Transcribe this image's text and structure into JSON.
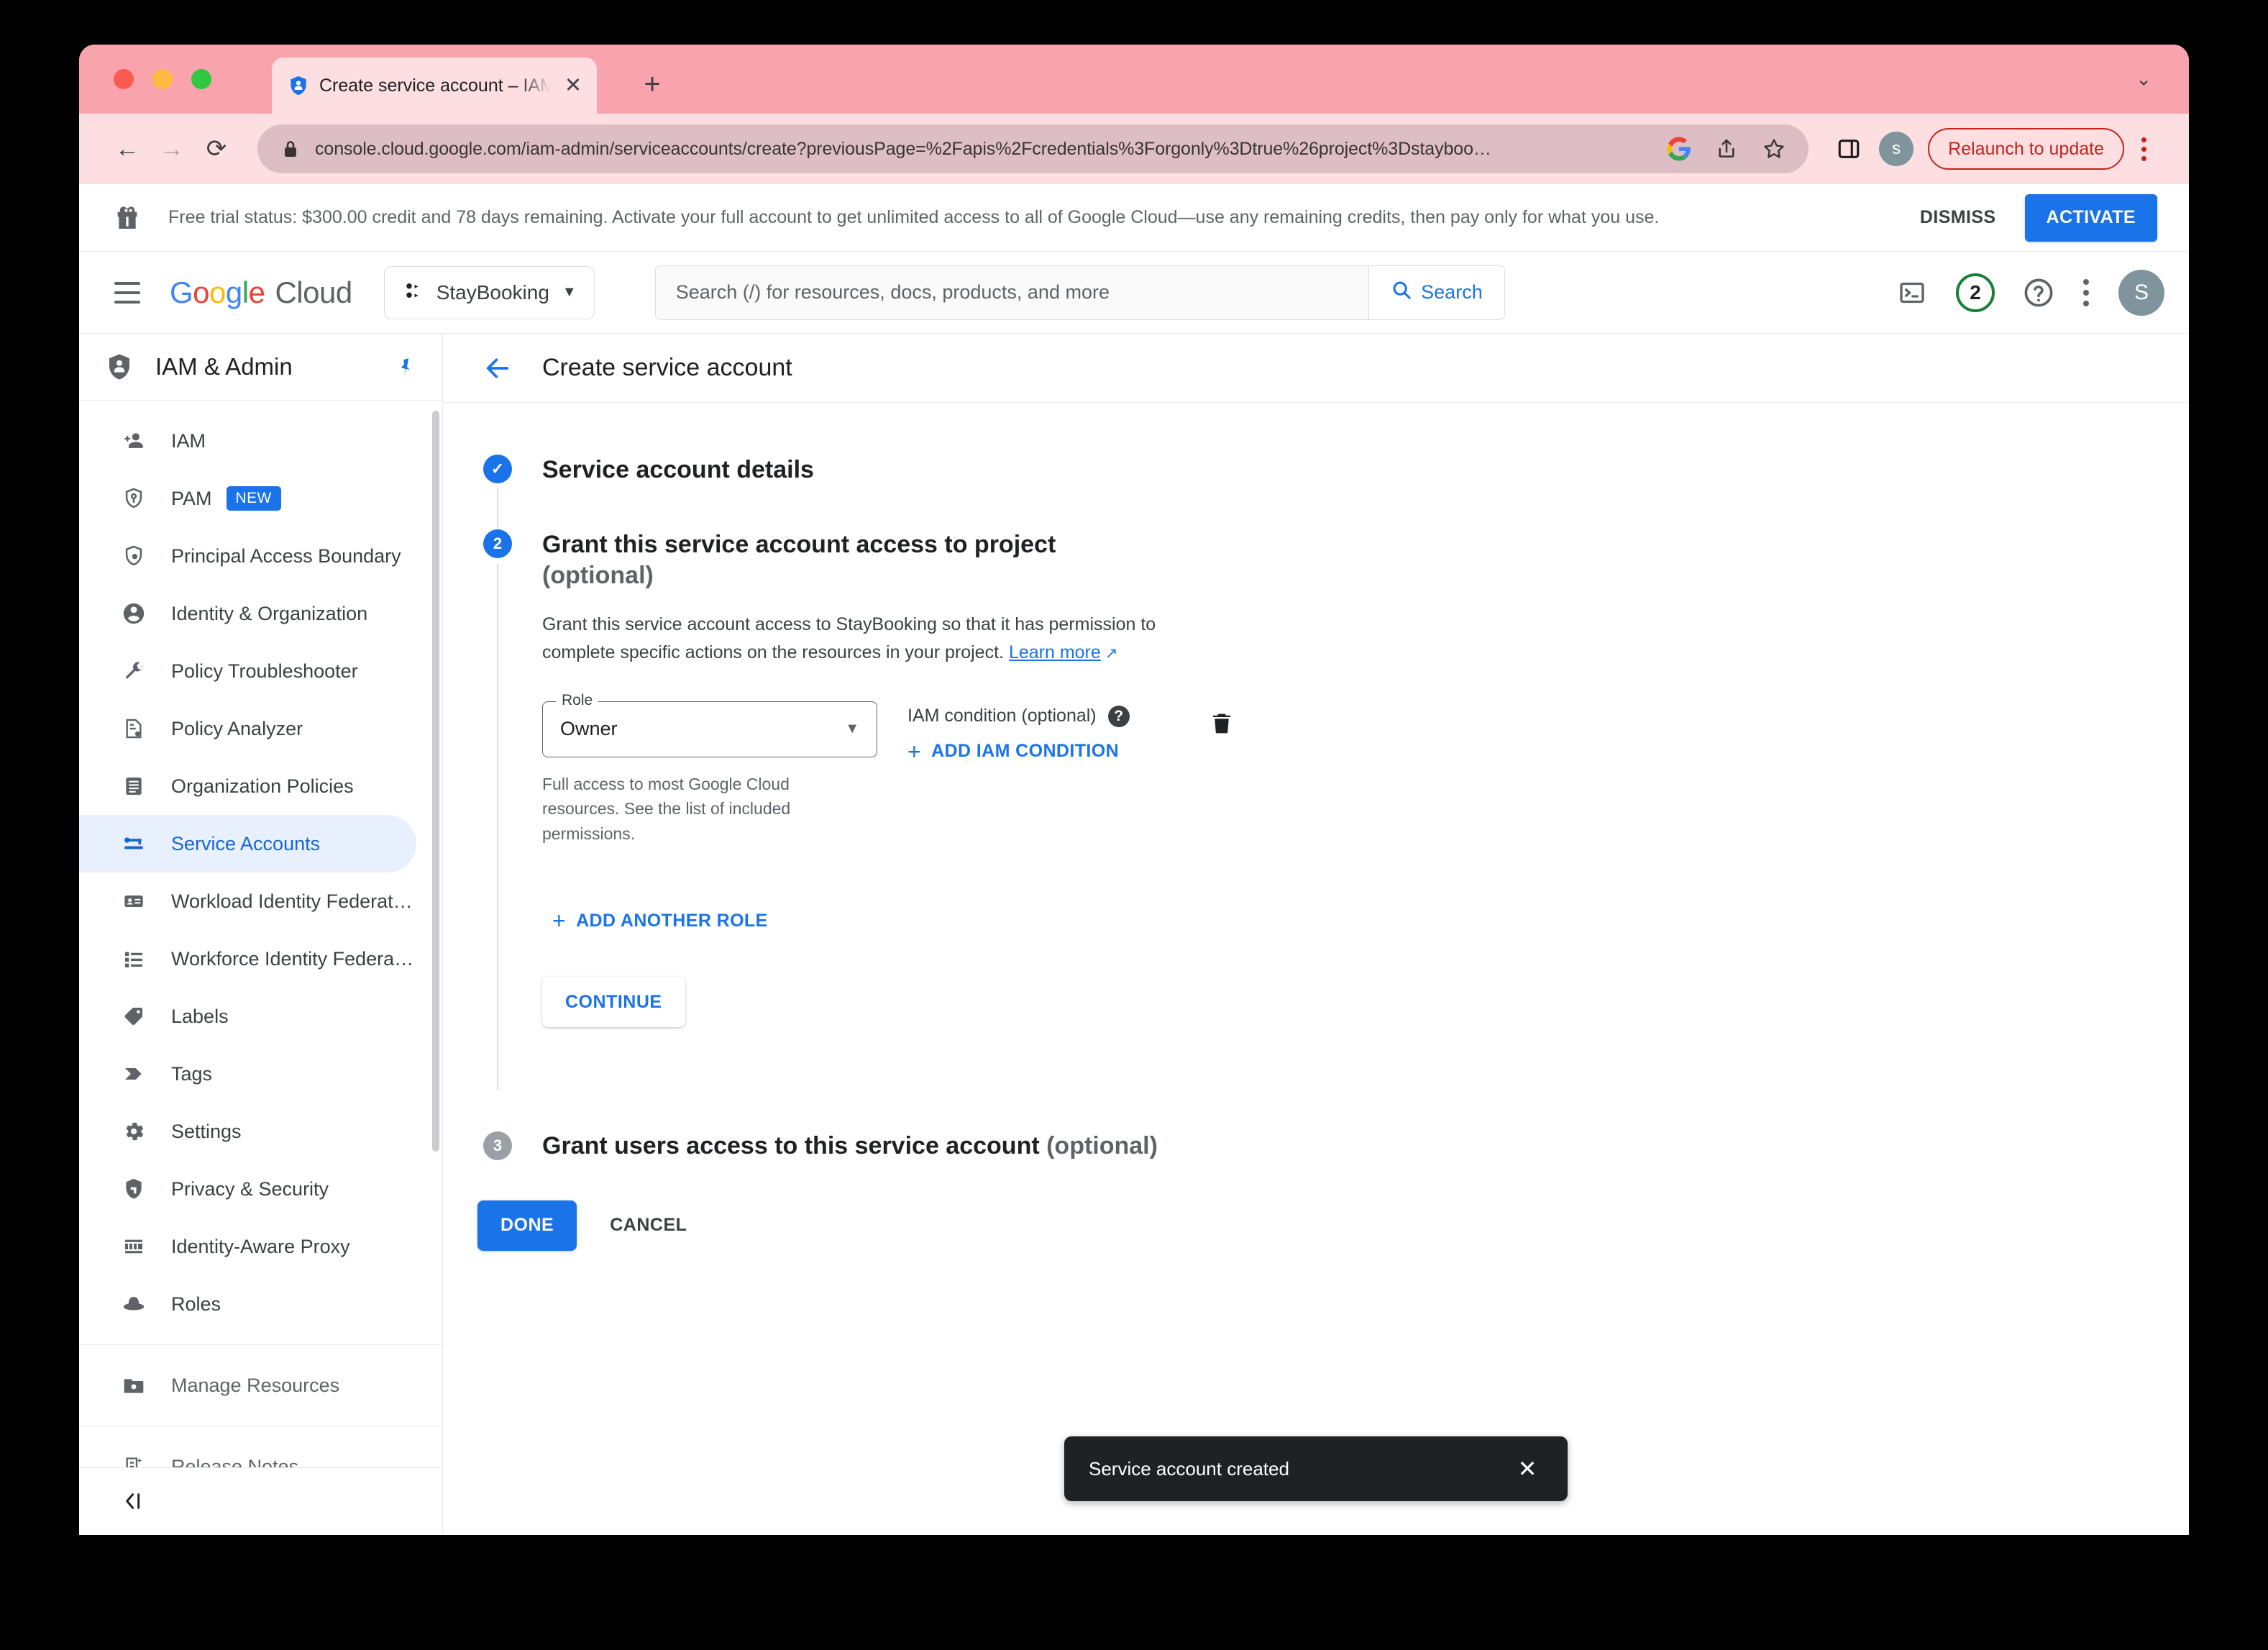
{
  "browser": {
    "tab": {
      "title": "Create service account – IAM & Admin",
      "favicon_name": "gcp-iam-shield-favicon",
      "close_glyph": "✕"
    },
    "new_tab_glyph": "+",
    "tab_list_caret": "⌄",
    "nav": {
      "back_glyph": "←",
      "forward_glyph": "→",
      "reload_glyph": "⟳"
    },
    "omnibox": {
      "url_visible": "console.cloud.google.com/iam-admin/serviceaccounts/create?previousPage=%2Fapis%2Fcredentials%3Forgonly%3Dtrue%26project%3Dstayboo…",
      "url_domain": "console.cloud.google.com",
      "url_path": "/iam-admin/serviceaccounts/create?previousPage=%2Fapis%2Fcredentials%3Forgonly%3Dtrue%26project%3Dstayboo…",
      "lock_icon_name": "lock-icon",
      "google_icon_name": "google-g-icon",
      "share_icon_name": "share-icon",
      "bookmark_icon_name": "star-icon"
    },
    "toolbar": {
      "side_panel_icon_name": "side-panel-icon",
      "profile_initial": "s",
      "relaunch_label": "Relaunch to update",
      "menu_icon_name": "kebab-menu-icon"
    }
  },
  "trial_banner": {
    "icon_name": "gift-icon",
    "message": "Free trial status: $300.00 credit and 78 days remaining. Activate your full account to get unlimited access to all of Google Cloud—use any remaining credits, then pay only for what you use.",
    "dismiss_label": "DISMISS",
    "activate_label": "ACTIVATE"
  },
  "header": {
    "menu_icon_name": "hamburger-menu-icon",
    "logo": {
      "g1": "G",
      "o1": "o",
      "o2": "o",
      "g2": "g",
      "l1": "l",
      "e1": "e",
      "cloud": "Cloud"
    },
    "project": {
      "name": "StayBooking",
      "icon_name": "project-selector-icon",
      "caret": "▼"
    },
    "search": {
      "placeholder": "Search (/) for resources, docs, products, and more",
      "button_label": "Search",
      "icon_name": "search-icon"
    },
    "cloud_shell_icon_name": "cloud-shell-terminal-icon",
    "notifications_count": "2",
    "help_icon_name": "help-circle-icon",
    "more_icon_name": "more-vert-icon",
    "avatar_initial": "S"
  },
  "sidebar": {
    "title": "IAM & Admin",
    "title_icon_name": "iam-admin-shield-icon",
    "pin_icon_name": "pin-icon",
    "collapse_icon_name": "collapse-panel-icon",
    "items": [
      {
        "label": "IAM",
        "icon": "person-add-icon"
      },
      {
        "label": "PAM",
        "icon": "pam-shield-key-icon",
        "badge": "NEW"
      },
      {
        "label": "Principal Access Boundary",
        "icon": "shield-person-icon"
      },
      {
        "label": "Identity & Organization",
        "icon": "account-circle-icon"
      },
      {
        "label": "Policy Troubleshooter",
        "icon": "wrench-icon"
      },
      {
        "label": "Policy Analyzer",
        "icon": "document-search-icon"
      },
      {
        "label": "Organization Policies",
        "icon": "list-document-icon"
      },
      {
        "label": "Service Accounts",
        "icon": "key-card-icon",
        "active": true
      },
      {
        "label": "Workload Identity Federat…",
        "icon": "id-card-icon"
      },
      {
        "label": "Workforce Identity Federa…",
        "icon": "list-bullets-icon"
      },
      {
        "label": "Labels",
        "icon": "label-tag-icon"
      },
      {
        "label": "Tags",
        "icon": "tag-arrow-icon"
      },
      {
        "label": "Settings",
        "icon": "gear-icon"
      },
      {
        "label": "Privacy & Security",
        "icon": "shield-check-icon"
      },
      {
        "label": "Identity-Aware Proxy",
        "icon": "iap-icon"
      },
      {
        "label": "Roles",
        "icon": "hat-roles-icon"
      }
    ],
    "footer_items": [
      {
        "label": "Manage Resources",
        "icon": "folder-settings-icon"
      },
      {
        "label": "Release Notes",
        "icon": "release-notes-icon"
      }
    ]
  },
  "main": {
    "back_arrow_glyph": "←",
    "page_title": "Create service account",
    "steps": [
      {
        "number": "✓",
        "state": "done",
        "title": "Service account details"
      },
      {
        "number": "2",
        "state": "current",
        "title": "Grant this service account access to project",
        "optional": "(optional)",
        "description_before": "Grant this service account access to StayBooking so that it has permission to complete specific actions on the resources in your project. ",
        "learn_more": "Learn more",
        "learn_more_glyph": "↗",
        "role": {
          "field_label": "Role",
          "value": "Owner",
          "caret": "▼",
          "help_text": "Full access to most Google Cloud resources. See the list of included permissions."
        },
        "condition": {
          "label": "IAM condition (optional)",
          "help_glyph": "?",
          "add_label": "ADD IAM CONDITION",
          "plus_glyph": "+"
        },
        "delete_icon_name": "trash-icon",
        "add_another_role_label": "ADD ANOTHER ROLE",
        "add_another_role_plus": "+",
        "continue_label": "CONTINUE"
      },
      {
        "number": "3",
        "state": "pending",
        "title": "Grant users access to this service account",
        "optional": "(optional)"
      }
    ],
    "done_label": "DONE",
    "cancel_label": "CANCEL"
  },
  "snackbar": {
    "message": "Service account created",
    "close_glyph": "✕"
  },
  "colors": {
    "accent_blue": "#1a73e8",
    "active_nav_bg": "#e8f0fe",
    "active_nav_text": "#1967d2",
    "notification_ring": "#188038",
    "relaunch_red": "#c5221f",
    "snackbar_bg": "#202124",
    "browser_chrome": "#f9a3ad"
  }
}
